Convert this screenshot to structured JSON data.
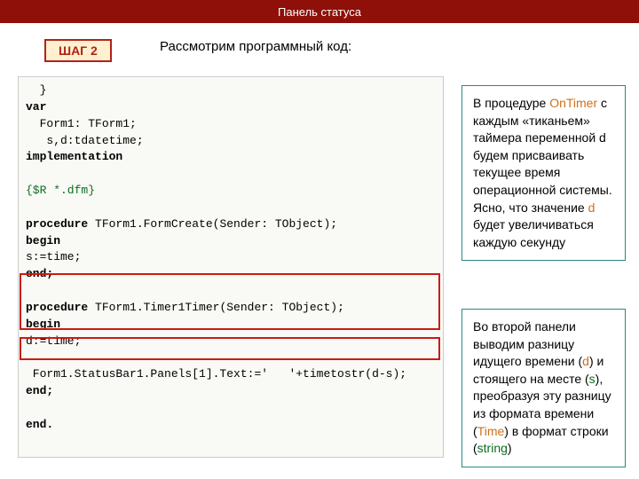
{
  "header": {
    "title": "Панель статуса"
  },
  "step": {
    "label": "ШАГ 2"
  },
  "intro": "Рассмотрим программный код:",
  "code": {
    "l0": "  }",
    "l1": "var",
    "l2": "  Form1: TForm1;",
    "l3": "   s,d:tdatetime;",
    "l4": "implementation",
    "l5": "",
    "l6": "{$R *.dfm}",
    "l7": "",
    "l8": "procedure",
    "l8b": " TForm1.FormCreate(Sender: TObject);",
    "l9": "begin",
    "l10": "s:=time;",
    "l11": "end;",
    "l12": "",
    "l13": "procedure",
    "l13b": " TForm1.Timer1Timer(Sender: TObject);",
    "l14": "begin",
    "l15": "d:=time;",
    "l16": "",
    "l17": " Form1.StatusBar1.Panels[1].Text:='   '+timetostr(d-s);",
    "l18": "end;",
    "l19": "",
    "l20": "end."
  },
  "callout1": {
    "p1a": " В процедуре ",
    "p1b": "OnTimer",
    "p1c": " с каждым «тиканьем» таймера переменной d будем присваивать текущее время операционной системы. Ясно, что значение ",
    "p1d": "d",
    "p1e": " будет увеличиваться каждую секунду"
  },
  "callout2": {
    "p2a": " Во второй панели выводим разницу идущего времени (",
    "p2b": "d",
    "p2c": ") и стоящего на месте (",
    "p2d": "s",
    "p2e": "), преобразуя эту разницу из формата времени (",
    "p2f": "Time",
    "p2g": ") в формат строки (",
    "p2h": "string",
    "p2i": ")"
  }
}
